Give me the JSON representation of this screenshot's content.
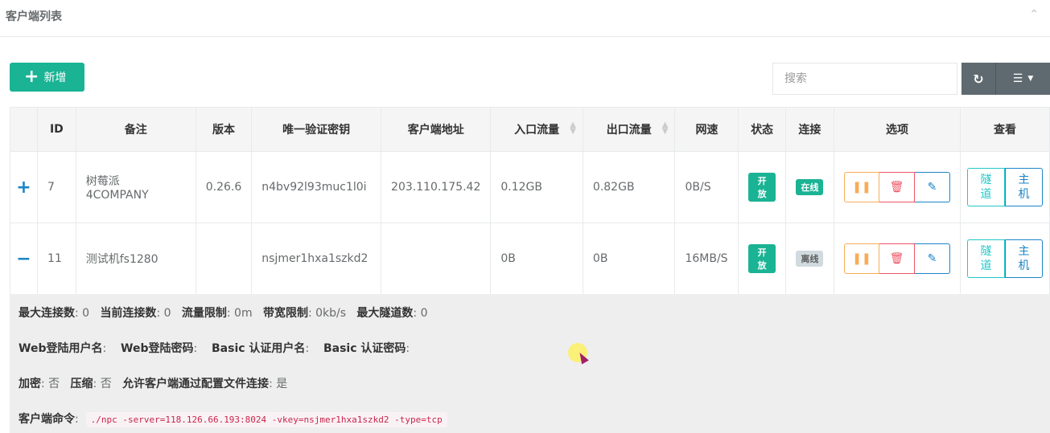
{
  "panel": {
    "title": "客户端列表"
  },
  "toolbar": {
    "add_label": "新增",
    "search_placeholder": "搜索"
  },
  "table": {
    "columns": [
      "ID",
      "备注",
      "版本",
      "唯一验证密钥",
      "客户端地址",
      "入口流量",
      "出口流量",
      "网速",
      "状态",
      "连接",
      "选项",
      "查看"
    ],
    "rows": [
      {
        "toggle": "+",
        "id": "7",
        "remark_line1": "树莓派",
        "remark_line2": "4COMPANY",
        "version": "0.26.6",
        "vkey": "n4bv92l93muc1l0i",
        "addr": "203.110.175.42",
        "in_flow": "0.12GB",
        "out_flow": "0.82GB",
        "speed": "0B/S",
        "status": "开放",
        "connect": "在线",
        "view_tunnel": "隧道",
        "view_host": "主机"
      },
      {
        "toggle": "−",
        "id": "11",
        "remark_line1": "测试机fs1280",
        "remark_line2": "",
        "version": "",
        "vkey": "nsjmer1hxa1szkd2",
        "addr": "",
        "in_flow": "0B",
        "out_flow": "0B",
        "speed": "16MB/S",
        "status": "开放",
        "connect": "离线",
        "view_tunnel": "隧道",
        "view_host": "主机"
      }
    ]
  },
  "detail": {
    "max_conn_label": "最大连接数",
    "max_conn": ": 0",
    "cur_conn_label": "当前连接数",
    "cur_conn": ": 0",
    "flow_limit_label": "流量限制",
    "flow_limit": ": 0m",
    "rate_limit_label": "带宽限制",
    "rate_limit": ": 0kb/s",
    "max_tunnel_label": "最大隧道数",
    "max_tunnel": ": 0",
    "web_user_label": "Web登陆用户名",
    "web_user": ":",
    "web_pass_label": "Web登陆密码",
    "web_pass": ":",
    "basic_user_label": "Basic 认证用户名",
    "basic_user": ":",
    "basic_pass_label": "Basic 认证密码",
    "basic_pass": ":",
    "encrypt_label": "加密",
    "encrypt": ": 否",
    "compress_label": "压缩",
    "compress": ": 否",
    "config_conn_label": "允许客户端通过配置文件连接",
    "config_conn": ": 是",
    "cmd_label": "客户端命令",
    "cmd_sep": ":",
    "cmd": "./npc -server=118.126.66.193:8024 -vkey=nsjmer1hxa1szkd2 -type=tcp"
  },
  "colors": {
    "primary": "#1ab394",
    "info": "#1c84c6",
    "warning": "#f8ac59",
    "danger": "#ed5565",
    "dark_button": "#5e6a70"
  }
}
